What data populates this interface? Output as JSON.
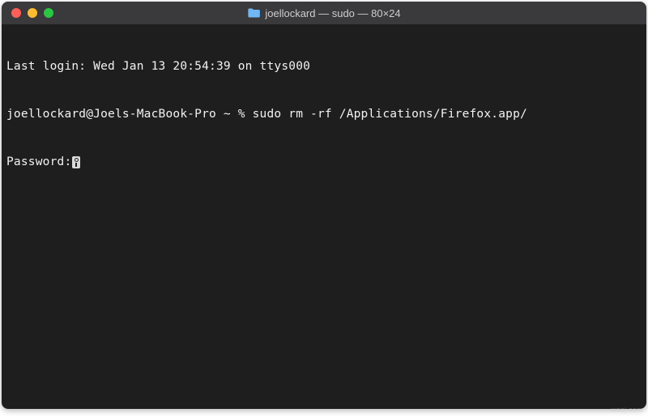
{
  "window": {
    "title": "joellockard — sudo — 80×24"
  },
  "terminal": {
    "last_login": "Last login: Wed Jan 13 20:54:39 on ttys000",
    "prompt_line": "joellockard@Joels-MacBook-Pro ~ % sudo rm -rf /Applications/Firefox.app/",
    "password_label": "Password:"
  },
  "watermark": "wssj.com"
}
